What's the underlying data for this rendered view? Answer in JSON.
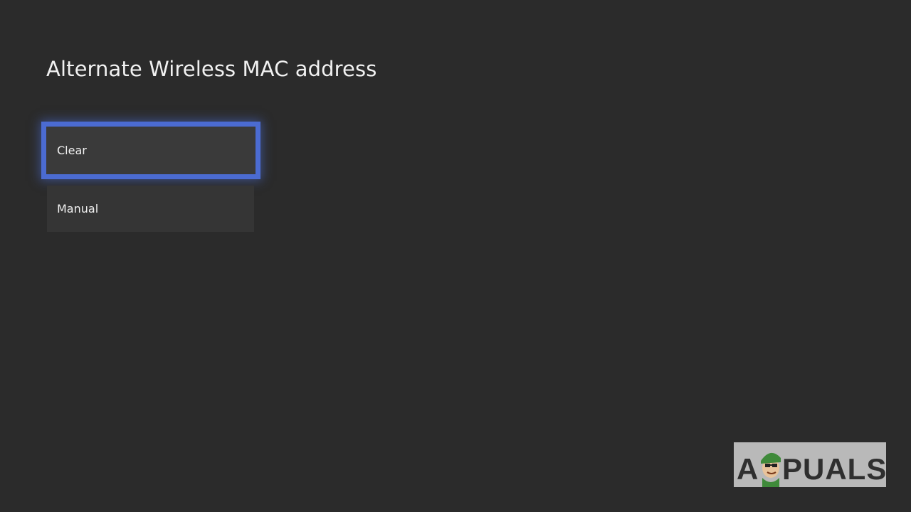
{
  "page": {
    "title": "Alternate Wireless MAC address"
  },
  "options": [
    {
      "label": "Clear",
      "focused": true
    },
    {
      "label": "Manual",
      "focused": false
    }
  ],
  "watermark": {
    "text": "APPUALS",
    "icon": "appuals-mascot-icon"
  },
  "colors": {
    "background": "#2b2b2b",
    "focus_border": "#4b6bd1",
    "tile": "#383838",
    "watermark_bg": "#b9b9b9",
    "watermark_text": "#2f2f2f"
  }
}
